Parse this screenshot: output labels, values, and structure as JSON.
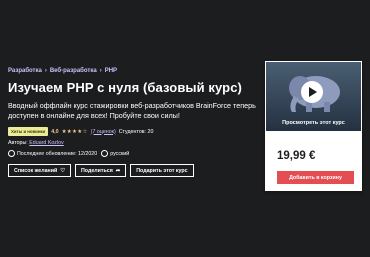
{
  "breadcrumb": {
    "items": [
      "Разработка",
      "Веб-разработка",
      "PHP"
    ]
  },
  "course": {
    "title": "Изучаем PHP с нуля (базовый курс)",
    "subtitle": "Вводный оффлайн курс стажировки веб-разработчиков BrainForce теперь доступен в онлайне для всех! Пробуйте свои силы!",
    "badge": "Хиты и новинки",
    "rating": "4,0",
    "stars": "★★★★☆",
    "reviews": "(7 оценок)",
    "students": "Студентов: 20",
    "authors_label": "Авторы:",
    "author": "Eduard Kozlov",
    "updated": "Последнее обновление: 12/2020",
    "language": "русский"
  },
  "actions": {
    "wishlist": "Список желаний",
    "share": "Поделиться",
    "gift": "Подарить этот курс"
  },
  "sidebar": {
    "preview_label": "Просмотреть этот курс",
    "price": "19,99 €",
    "add_to_cart": "Добавить в корзину"
  },
  "colors": {
    "accent": "#cec0fc",
    "cart": "#e44e53",
    "badge": "#eceb98",
    "star": "#f3ca8c",
    "bg": "#1c1d1f"
  }
}
